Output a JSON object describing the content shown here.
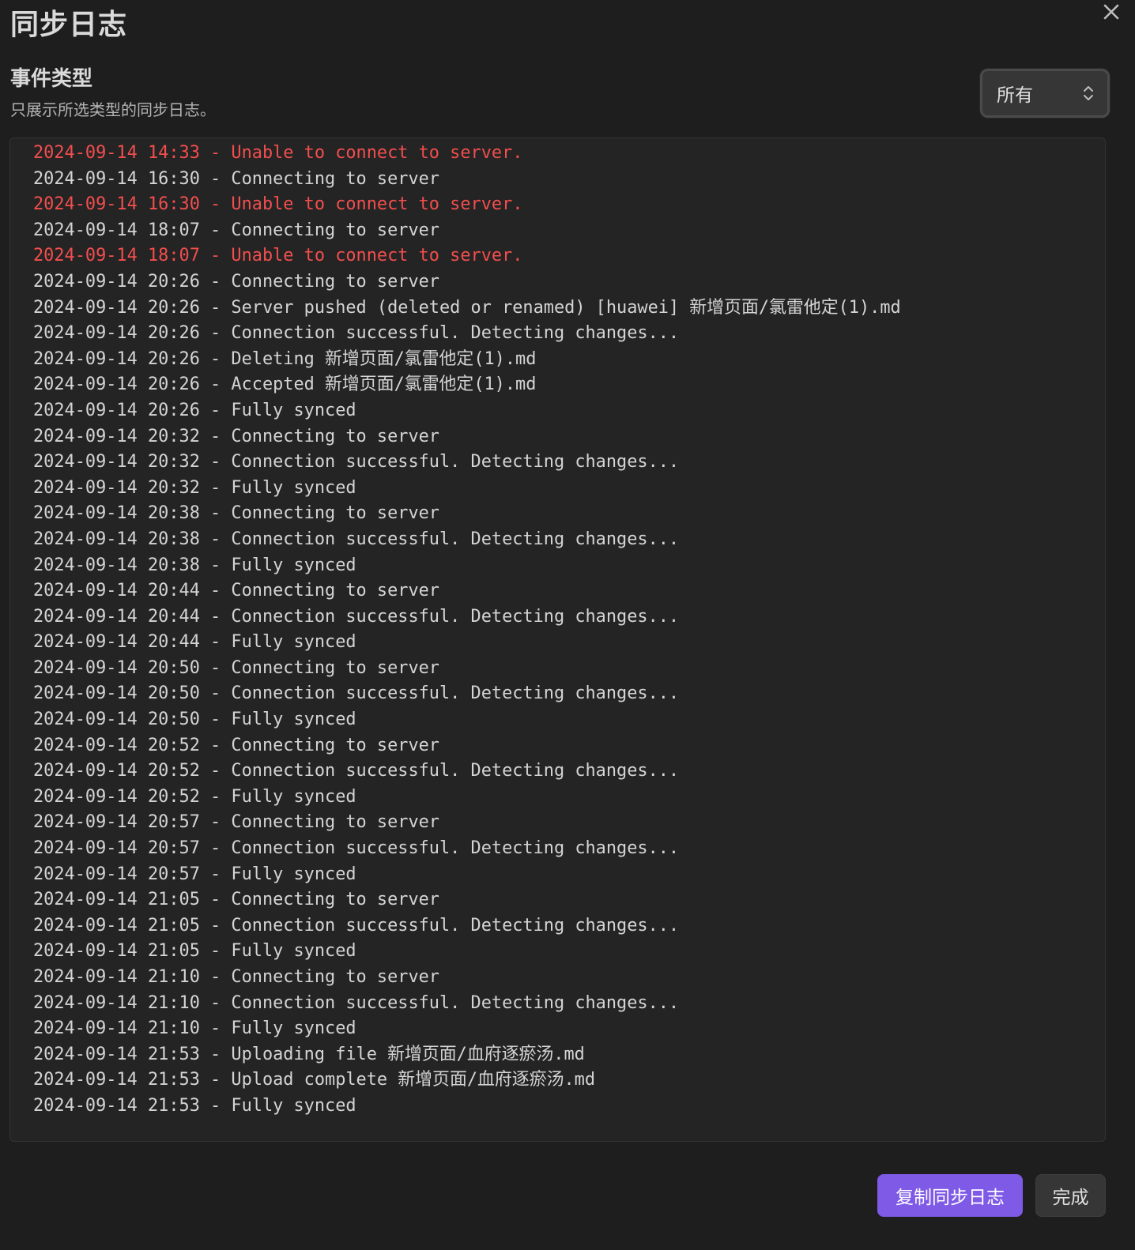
{
  "modal": {
    "title": "同步日志",
    "close_icon": "close-icon"
  },
  "setting": {
    "name": "事件类型",
    "description": "只展示所选类型的同步日志。",
    "dropdown_value": "所有",
    "dropdown_icon": "chevron-up-down-icon"
  },
  "colors": {
    "error": "#f24e4e",
    "accent": "#7f5ae6",
    "background": "#1e1e1e",
    "panel": "#242424"
  },
  "log": [
    {
      "text": "2024-09-14 14:33 - Unable to connect to server.",
      "level": "error"
    },
    {
      "text": "2024-09-14 16:30 - Connecting to server",
      "level": "info"
    },
    {
      "text": "2024-09-14 16:30 - Unable to connect to server.",
      "level": "error"
    },
    {
      "text": "2024-09-14 18:07 - Connecting to server",
      "level": "info"
    },
    {
      "text": "2024-09-14 18:07 - Unable to connect to server.",
      "level": "error"
    },
    {
      "text": "2024-09-14 20:26 - Connecting to server",
      "level": "info"
    },
    {
      "text": "2024-09-14 20:26 - Server pushed (deleted or renamed) [huawei] 新增页面/氯雷他定(1).md",
      "level": "info"
    },
    {
      "text": "2024-09-14 20:26 - Connection successful. Detecting changes...",
      "level": "info"
    },
    {
      "text": "2024-09-14 20:26 - Deleting 新增页面/氯雷他定(1).md",
      "level": "info"
    },
    {
      "text": "2024-09-14 20:26 - Accepted 新增页面/氯雷他定(1).md",
      "level": "info"
    },
    {
      "text": "2024-09-14 20:26 - Fully synced",
      "level": "info"
    },
    {
      "text": "2024-09-14 20:32 - Connecting to server",
      "level": "info"
    },
    {
      "text": "2024-09-14 20:32 - Connection successful. Detecting changes...",
      "level": "info"
    },
    {
      "text": "2024-09-14 20:32 - Fully synced",
      "level": "info"
    },
    {
      "text": "2024-09-14 20:38 - Connecting to server",
      "level": "info"
    },
    {
      "text": "2024-09-14 20:38 - Connection successful. Detecting changes...",
      "level": "info"
    },
    {
      "text": "2024-09-14 20:38 - Fully synced",
      "level": "info"
    },
    {
      "text": "2024-09-14 20:44 - Connecting to server",
      "level": "info"
    },
    {
      "text": "2024-09-14 20:44 - Connection successful. Detecting changes...",
      "level": "info"
    },
    {
      "text": "2024-09-14 20:44 - Fully synced",
      "level": "info"
    },
    {
      "text": "2024-09-14 20:50 - Connecting to server",
      "level": "info"
    },
    {
      "text": "2024-09-14 20:50 - Connection successful. Detecting changes...",
      "level": "info"
    },
    {
      "text": "2024-09-14 20:50 - Fully synced",
      "level": "info"
    },
    {
      "text": "2024-09-14 20:52 - Connecting to server",
      "level": "info"
    },
    {
      "text": "2024-09-14 20:52 - Connection successful. Detecting changes...",
      "level": "info"
    },
    {
      "text": "2024-09-14 20:52 - Fully synced",
      "level": "info"
    },
    {
      "text": "2024-09-14 20:57 - Connecting to server",
      "level": "info"
    },
    {
      "text": "2024-09-14 20:57 - Connection successful. Detecting changes...",
      "level": "info"
    },
    {
      "text": "2024-09-14 20:57 - Fully synced",
      "level": "info"
    },
    {
      "text": "2024-09-14 21:05 - Connecting to server",
      "level": "info"
    },
    {
      "text": "2024-09-14 21:05 - Connection successful. Detecting changes...",
      "level": "info"
    },
    {
      "text": "2024-09-14 21:05 - Fully synced",
      "level": "info"
    },
    {
      "text": "2024-09-14 21:10 - Connecting to server",
      "level": "info"
    },
    {
      "text": "2024-09-14 21:10 - Connection successful. Detecting changes...",
      "level": "info"
    },
    {
      "text": "2024-09-14 21:10 - Fully synced",
      "level": "info"
    },
    {
      "text": "2024-09-14 21:53 - Uploading file 新增页面/血府逐瘀汤.md",
      "level": "info"
    },
    {
      "text": "2024-09-14 21:53 - Upload complete 新增页面/血府逐瘀汤.md",
      "level": "info"
    },
    {
      "text": "2024-09-14 21:53 - Fully synced",
      "level": "info"
    }
  ],
  "footer": {
    "copy_label": "复制同步日志",
    "done_label": "完成"
  }
}
